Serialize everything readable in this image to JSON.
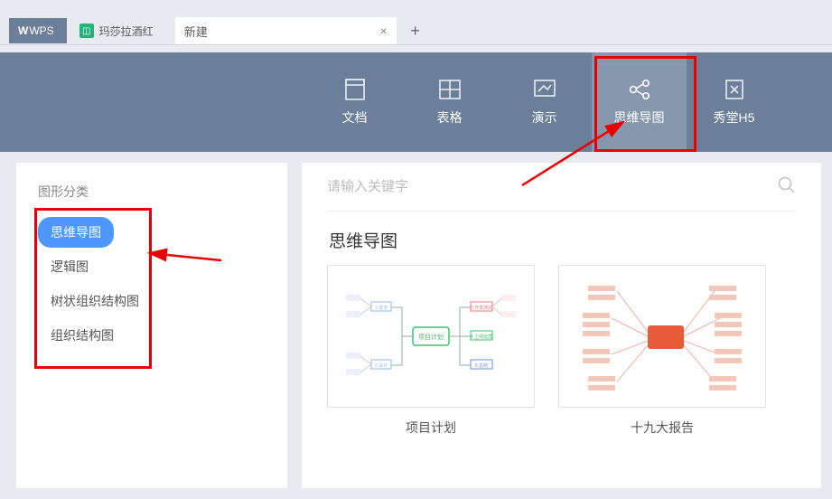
{
  "tabs": {
    "wps": "WPS",
    "file": {
      "icon_letter": "◫",
      "name": "玛莎拉酒红"
    },
    "new": "新建"
  },
  "ribbon": {
    "items": [
      {
        "label": "文档"
      },
      {
        "label": "表格"
      },
      {
        "label": "演示"
      },
      {
        "label": "思维导图"
      },
      {
        "label": "秀堂H5"
      }
    ]
  },
  "sidebar": {
    "title": "图形分类",
    "items": [
      {
        "label": "思维导图",
        "active": true
      },
      {
        "label": "逻辑图"
      },
      {
        "label": "树状组织结构图"
      },
      {
        "label": "组织结构图"
      }
    ]
  },
  "search": {
    "placeholder": "请输入关键字"
  },
  "main": {
    "section_title": "思维导图",
    "templates": [
      {
        "name": "项目计划"
      },
      {
        "name": "十九大报告"
      }
    ]
  },
  "colors": {
    "ribbon_bg": "#6b7f9a",
    "active_ribbon": "#8697ae",
    "annotation_red": "#e60000",
    "pill_blue": "#4d97ff"
  }
}
